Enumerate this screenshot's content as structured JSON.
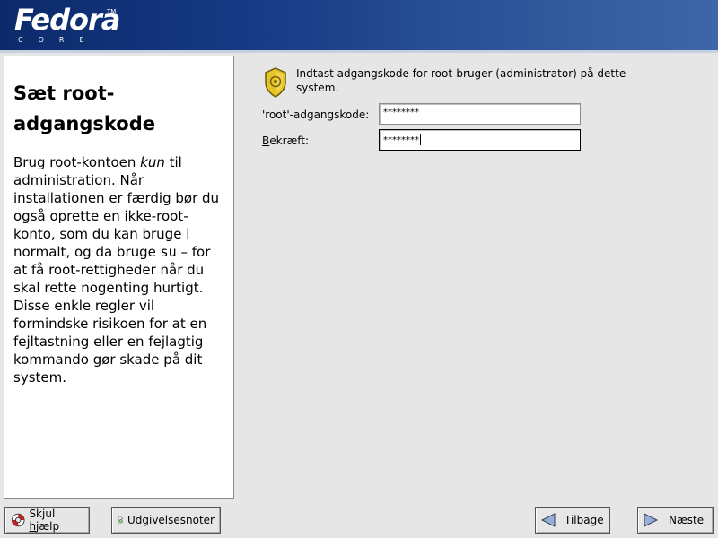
{
  "banner": {
    "logo_text": "Fedora",
    "logo_tm": "TM",
    "logo_sub": "CORE"
  },
  "help": {
    "title": "Sæt root-adgangskode",
    "body_part1": "Brug root-kontoen ",
    "body_emph": "kun",
    "body_part2": " til administration. Når installationen er færdig bør du også oprette en ikke-root-konto, som du kan bruge i normalt, og da bruge ",
    "body_code": "su",
    "body_part3": "  – for at få root-rettigheder når du skal rette nogenting hurtigt. Disse enkle regler vil formindske risikoen for at en fejltastning eller en fejlagtig kommando gør skade på dit system."
  },
  "form": {
    "prompt": "Indtast adgangskode for root-bruger (administrator) på dette system.",
    "root_password_label": "'root'-adgangskode:",
    "root_password_value": "********",
    "confirm_label_mnemonic": "B",
    "confirm_label_rest": "ekræft:",
    "confirm_value": "********"
  },
  "buttons": {
    "hide_help": {
      "pre": "Skjul ",
      "mnemonic": "h",
      "post": "jælp"
    },
    "release_notes": {
      "pre": "",
      "mnemonic": "U",
      "post": "dgivelsesnoter"
    },
    "back": {
      "pre": "",
      "mnemonic": "T",
      "post": "ilbage"
    },
    "next": {
      "pre": "",
      "mnemonic": "N",
      "post": "æste"
    }
  },
  "icons": {
    "key": "key-badge-icon",
    "help": "lifebuoy-icon",
    "notes": "document-arrow-icon",
    "back": "arrow-left-icon",
    "next": "arrow-right-icon"
  },
  "colors": {
    "banner": "#163a85",
    "background": "#e6e6e6",
    "panel": "#ffffff"
  }
}
